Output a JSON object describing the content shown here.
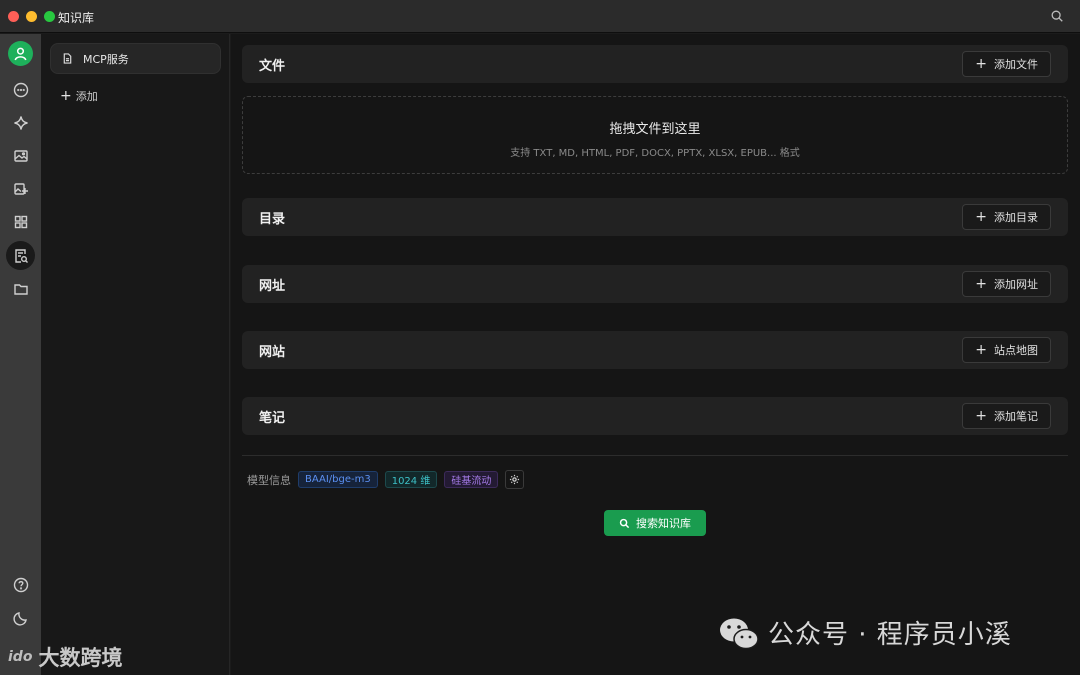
{
  "window": {
    "title": "知识库"
  },
  "sidebar": {
    "items": [
      {
        "label": "MCP服务",
        "icon": "file-icon"
      }
    ],
    "add_label": "添加"
  },
  "rail": {
    "icons": [
      "avatar",
      "chat-icon",
      "sparkle-icon",
      "image-icon",
      "image-edit-icon",
      "apps-icon",
      "knowledge-base-icon",
      "folder-icon",
      "help-icon",
      "moon-icon",
      "settings-icon"
    ],
    "active": "knowledge-base-icon"
  },
  "sections": [
    {
      "title": "文件",
      "button": "添加文件"
    },
    {
      "title": "目录",
      "button": "添加目录"
    },
    {
      "title": "网址",
      "button": "添加网址"
    },
    {
      "title": "网站",
      "button": "站点地图"
    },
    {
      "title": "笔记",
      "button": "添加笔记"
    }
  ],
  "dropzone": {
    "title": "拖拽文件到这里",
    "subtitle": "支持 TXT, MD, HTML, PDF, DOCX, PPTX, XLSX, EPUB... 格式"
  },
  "model_info": {
    "label": "模型信息",
    "model": "BAAI/bge-m3",
    "dims": "1024 维",
    "provider": "硅基流动"
  },
  "search_button": "搜索知识库",
  "watermarks": {
    "wechat": "公众号 · 程序员小溪",
    "brand": "大数跨境",
    "brand_logo": "ido"
  },
  "colors": {
    "accent_green": "#1a9c4f",
    "tag_blue": "#5b8ff0",
    "tag_cyan": "#3dc0c6",
    "tag_purple": "#a57be8"
  }
}
